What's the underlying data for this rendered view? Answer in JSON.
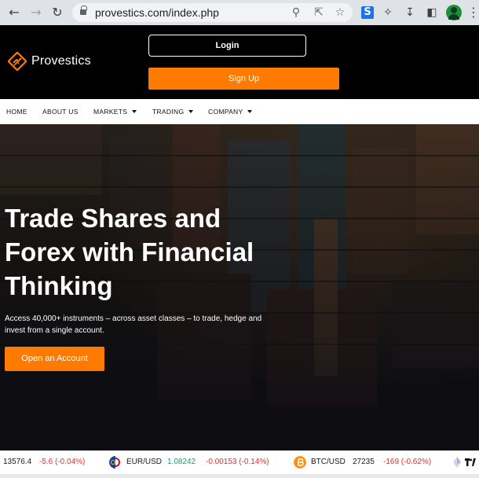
{
  "browser": {
    "url": "provestics.com/index.php",
    "nav_icons": [
      "back-arrow-icon",
      "forward-arrow-icon",
      "reload-icon"
    ],
    "omnibox_icons": [
      "zoom-icon",
      "share-icon",
      "bookmark-star-icon"
    ],
    "extension_icons": [
      "extension-s-icon",
      "extensions-puzzle-icon",
      "download-icon",
      "side-panel-icon",
      "profile-avatar-icon",
      "menu-kebab-icon"
    ]
  },
  "header": {
    "logo_text": "Provestics",
    "login_label": "Login",
    "signup_label": "Sign Up",
    "accent_color": "#ff7a00"
  },
  "nav": {
    "items": [
      {
        "label": "HOME",
        "has_dropdown": false
      },
      {
        "label": "ABOUT US",
        "has_dropdown": false
      },
      {
        "label": "MARKETS",
        "has_dropdown": true
      },
      {
        "label": "TRADING",
        "has_dropdown": true
      },
      {
        "label": "COMPANY",
        "has_dropdown": true
      }
    ]
  },
  "hero": {
    "title_line1": "Trade Shares and",
    "title_line2": "Forex with Financial",
    "title_line3": "Thinking",
    "subtitle": "Access 40,000+ instruments – across asset classes – to trade, hedge and invest from a single account.",
    "cta_label": "Open an Account"
  },
  "ticker": {
    "items": [
      {
        "symbol": "",
        "price": "13576.4",
        "change": "-5.6 (-0.04%)"
      },
      {
        "symbol": "EUR/USD",
        "price": "1.08242",
        "change": "-0.00153 (-0.14%)"
      },
      {
        "symbol": "BTC/USD",
        "price": "27235",
        "change": "-169 (-0.62%)"
      }
    ]
  }
}
